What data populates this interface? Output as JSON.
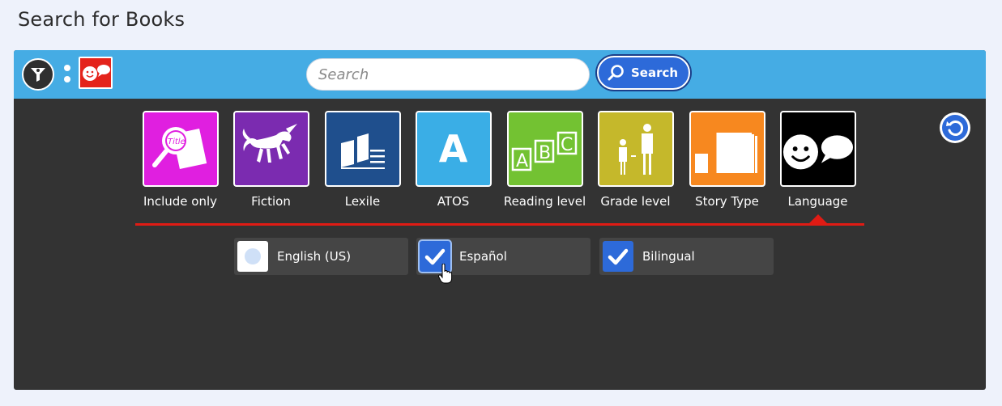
{
  "page": {
    "title": "Search for Books"
  },
  "toolbar": {
    "search_placeholder": "Search",
    "search_value": "",
    "search_button": "Search"
  },
  "categories": [
    {
      "label": "Include only",
      "color": "#e01fe0",
      "icon": "magnifier-title-icon"
    },
    {
      "label": "Fiction",
      "color": "#7b2bb0",
      "icon": "unicorn-icon"
    },
    {
      "label": "Lexile",
      "color": "#1f4f8d",
      "icon": "book-lines-icon"
    },
    {
      "label": "ATOS",
      "color": "#3aaee6",
      "icon": "letter-a-icon",
      "glyph": "A"
    },
    {
      "label": "Reading level",
      "color": "#73c232",
      "icon": "abc-blocks-icon"
    },
    {
      "label": "Grade level",
      "color": "#c5b82b",
      "icon": "people-grade-icon"
    },
    {
      "label": "Story Type",
      "color": "#f7881f",
      "icon": "books-stack-icon"
    },
    {
      "label": "Language",
      "color": "#000000",
      "icon": "face-speech-icon",
      "selected": true
    }
  ],
  "language_options": [
    {
      "label": "English (US)",
      "checked": false
    },
    {
      "label": "Español",
      "checked": true
    },
    {
      "label": "Bilingual",
      "checked": true
    }
  ],
  "colors": {
    "topbar": "#45ace4",
    "panel": "#333333",
    "accent_blue": "#2d6ad9",
    "divider_red": "#e01b14"
  }
}
